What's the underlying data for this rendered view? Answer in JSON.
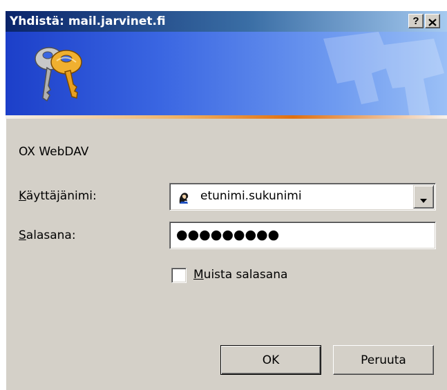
{
  "window": {
    "title": "Yhdistä: mail.jarvinet.fi",
    "help_label": "?"
  },
  "banner": {
    "icon": "keys-icon"
  },
  "form": {
    "server_label": "OX WebDAV",
    "username_label_mnemonic": "K",
    "username_label_rest": "äyttäjänimi:",
    "username_value": "etunimi.sukunimi",
    "username_icon": "user-icon",
    "password_label_mnemonic": "S",
    "password_label_rest": "alasana:",
    "password_masked": "●●●●●●●●●",
    "remember_checked": false,
    "remember_label_mnemonic": "M",
    "remember_label_rest": "uista salasana"
  },
  "buttons": {
    "ok_label": "OK",
    "cancel_label": "Peruuta"
  },
  "colors": {
    "title_bar": "#0a246a",
    "banner": "#3a66e2",
    "accent_line": "#e07010",
    "dialog_bg": "#d4d0c8"
  }
}
